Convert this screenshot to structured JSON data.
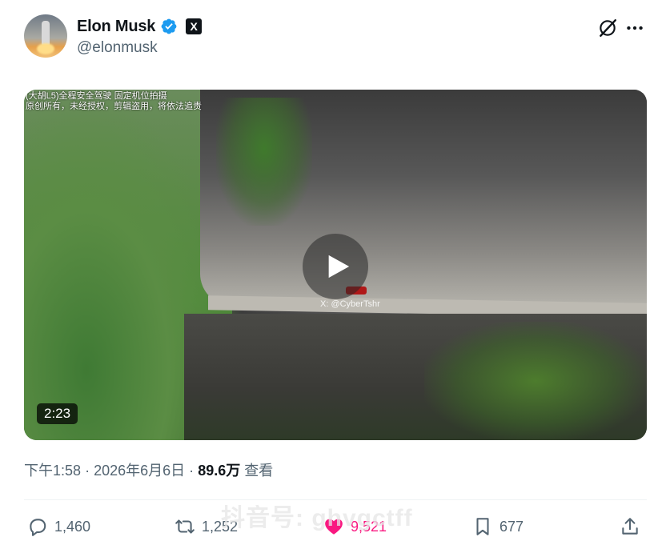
{
  "author": {
    "display_name": "Elon Musk",
    "handle": "@elonmusk",
    "verified": true,
    "affiliation_badge": "X"
  },
  "video": {
    "overlay_caption_line1": "(大胡L5)全程安全驾驶 固定机位拍摄",
    "overlay_caption_line2": "原创所有，未经授权，剪辑盗用，将依法追责",
    "watermark": "X: @CyberTshr",
    "duration": "2:23"
  },
  "meta": {
    "time": "下午1:58",
    "separator": "·",
    "date": "2026年6月6日",
    "views_count": "89.6万",
    "views_label": "查看"
  },
  "actions": {
    "replies": "1,460",
    "reposts": "1,252",
    "likes": "9,521",
    "bookmarks": "677"
  },
  "overlay_watermark": "抖音号: ghvgctff",
  "colors": {
    "verified_blue": "#1d9bf0",
    "like_pink": "#f91880",
    "secondary_text": "#536471"
  }
}
